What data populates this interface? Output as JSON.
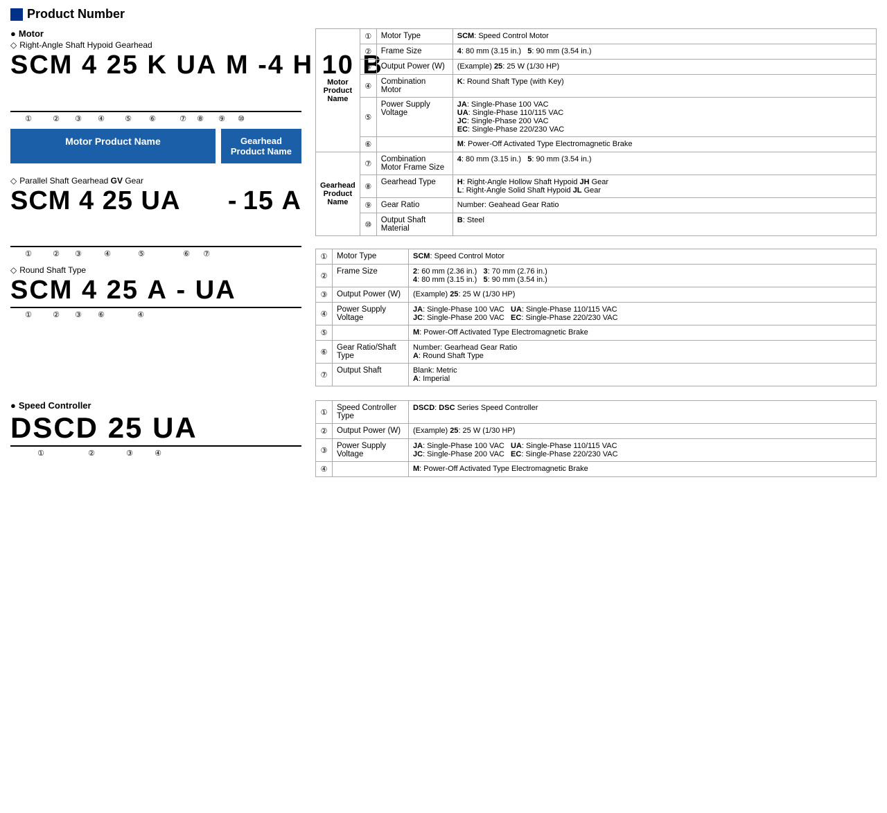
{
  "page": {
    "title": "Product Number",
    "sections": {
      "motor": {
        "label": "Motor",
        "subsections": {
          "right_angle": {
            "label": "Right-Angle Shaft Hypoid Gearhead",
            "code": "SCM 4 25 K UA M - 4 H 10 B",
            "parts": [
              "SCM",
              "4",
              "25",
              "K",
              "UA",
              "M",
              "-",
              "4",
              "H",
              "10",
              "B"
            ],
            "nums": [
              "①",
              "②",
              "③",
              "④",
              "⑤",
              "⑥",
              "",
              "⑦",
              "⑧",
              "⑨",
              "⑩"
            ],
            "motor_badge": "Motor Product Name",
            "gearhead_badge": "Gearhead Product Name"
          },
          "parallel_shaft": {
            "label": "Parallel Shaft Gearhead GV Gear",
            "code": "SCM 4 25 UA   - 15 A",
            "parts": [
              "SCM",
              "4",
              "25",
              "UA",
              "",
              "-",
              "15",
              "A"
            ],
            "nums": [
              "①",
              "②",
              "③",
              "④",
              "⑤",
              "",
              "⑥",
              "⑦"
            ]
          },
          "round_shaft": {
            "label": "Round Shaft Type",
            "code": "SCM 4 25 A - UA",
            "parts": [
              "SCM",
              "4",
              "25",
              "A",
              "-",
              "UA"
            ],
            "nums": [
              "①",
              "②",
              "③",
              "⑥",
              "",
              "④"
            ]
          }
        },
        "table1": {
          "group": "Motor Product Name",
          "rows": [
            {
              "num": "①",
              "field": "Motor Type",
              "value": "<b>SCM</b>: Speed Control Motor"
            },
            {
              "num": "②",
              "field": "Frame Size",
              "value": "<b>4</b>: 80 mm (3.15 in.)   <b>5</b>: 90 mm (3.54 in.)"
            },
            {
              "num": "③",
              "field": "Output Power (W)",
              "value": "(Example) <b>25</b>: 25 W (1/30 HP)"
            },
            {
              "num": "④",
              "field": "Combination Motor",
              "value": "<b>K</b>: Round Shaft Type (with Key)"
            },
            {
              "num": "⑤",
              "field": "Power Supply Voltage",
              "value": "<b>JA</b>: Single-Phase 100 VAC\n<b>UA</b>: Single-Phase 110/115 VAC\n<b>JC</b>: Single-Phase 200 VAC\n<b>EC</b>: Single-Phase 220/230 VAC"
            },
            {
              "num": "⑥",
              "field": "",
              "value": "<b>M</b>: Power-Off Activated Type Electromagnetic Brake"
            }
          ],
          "gearhead_group": "Gearhead Product Name",
          "gearhead_rows": [
            {
              "num": "⑦",
              "field": "Combination Motor Frame Size",
              "value": "<b>4</b>: 80 mm (3.15 in.)   <b>5</b>: 90 mm (3.54 in.)"
            },
            {
              "num": "⑧",
              "field": "Gearhead Type",
              "value": "<b>H</b>: Right-Angle Hollow Shaft Hypoid <b>JH</b> Gear\n<b>L</b>: Right-Angle Solid Shaft Hypoid <b>JL</b> Gear"
            },
            {
              "num": "⑨",
              "field": "Gear Ratio",
              "value": "Number: Geahead Gear Ratio"
            },
            {
              "num": "⑩",
              "field": "Output Shaft Material",
              "value": "<b>B</b>: Steel"
            }
          ]
        },
        "table2": {
          "rows": [
            {
              "num": "①",
              "field": "Motor Type",
              "value": "<b>SCM</b>: Speed Control Motor"
            },
            {
              "num": "②",
              "field": "Frame Size",
              "value": "<b>2</b>: 60 mm (2.36 in.)   <b>3</b>: 70 mm (2.76 in.)\n<b>4</b>: 80 mm (3.15 in.)   <b>5</b>: 90 mm (3.54 in.)"
            },
            {
              "num": "③",
              "field": "Output Power (W)",
              "value": "(Example) <b>25</b>: 25 W (1/30 HP)"
            },
            {
              "num": "④",
              "field": "Power Supply Voltage",
              "value": "<b>JA</b>: Single-Phase 100 VAC   <b>UA</b>: Single-Phase 110/115 VAC\n<b>JC</b>: Single-Phase 200 VAC   <b>EC</b>: Single-Phase 220/230 VAC"
            },
            {
              "num": "⑤",
              "field": "",
              "value": "<b>M</b>: Power-Off Activated Type Electromagnetic Brake"
            },
            {
              "num": "⑥",
              "field": "Gear Ratio/Shaft Type",
              "value": "Number: Gearhead Gear Ratio\n<b>A</b>: Round Shaft Type"
            },
            {
              "num": "⑦",
              "field": "Output Shaft",
              "value": "Blank: Metric\n<b>A</b>: Imperial"
            }
          ]
        }
      },
      "speed_controller": {
        "label": "Speed Controller",
        "code": "DSCD 25 UA",
        "parts": [
          "DSCD",
          "25",
          "UA"
        ],
        "nums": [
          "①",
          "②",
          "③",
          "④"
        ],
        "table": {
          "rows": [
            {
              "num": "①",
              "field": "Speed Controller Type",
              "value": "<b>DSCD</b>: <b>DSC</b> Series Speed Controller"
            },
            {
              "num": "②",
              "field": "Output Power (W)",
              "value": "(Example) <b>25</b>: 25 W (1/30 HP)"
            },
            {
              "num": "③",
              "field": "Power Supply Voltage",
              "value": "<b>JA</b>: Single-Phase 100 VAC   <b>UA</b>: Single-Phase 110/115 VAC\n<b>JC</b>: Single-Phase 200 VAC   <b>EC</b>: Single-Phase 220/230 VAC"
            },
            {
              "num": "④",
              "field": "",
              "value": "<b>M</b>: Power-Off Activated Type Electromagnetic Brake"
            }
          ]
        }
      }
    }
  }
}
